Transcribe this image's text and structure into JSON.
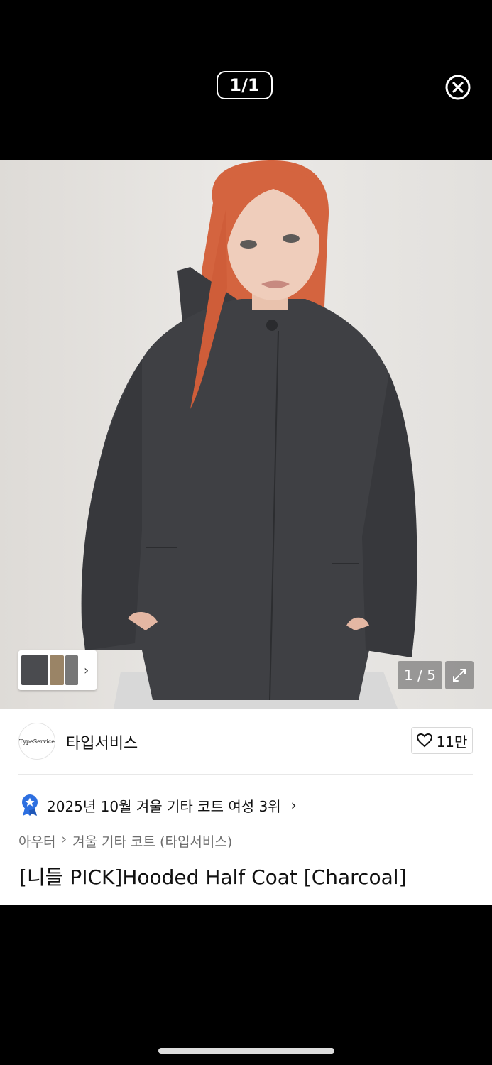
{
  "viewer": {
    "counter": "1/1"
  },
  "product": {
    "image_pager": "1 / 5",
    "brand": {
      "logo_text": "TypeService",
      "name": "타입서비스"
    },
    "likes": "11만",
    "ranking": "2025년 10월 겨울 기타 코트 여성 3위",
    "breadcrumb": {
      "category": "아우터",
      "subcategory": "겨울 기타 코트 (타입서비스)"
    },
    "title": "[니들 PICK]Hooded Half Coat [Charcoal]"
  },
  "colors": {
    "coat": "#3f4044",
    "hair": "#d4643f",
    "background": "#e6e4e1",
    "rank_badge": "#2d6fe0"
  },
  "icons": {
    "close": "close-circle-icon",
    "expand": "expand-icon",
    "heart": "heart-icon",
    "rank": "rank-medal-icon",
    "chevron": "chevron-right-icon"
  }
}
